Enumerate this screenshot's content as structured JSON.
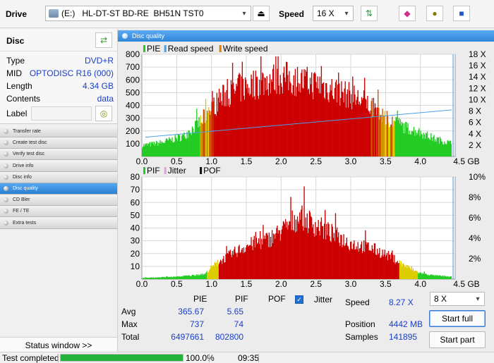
{
  "toolbar": {
    "drive_label": "Drive",
    "drive_value": "(E:)   HL-DT-ST BD-RE  BH51N TST0",
    "speed_label": "Speed",
    "speed_value": "16 X",
    "icons": [
      "eject-icon",
      "refresh-icon",
      "eraser-icon",
      "disc-copy-icon",
      "save-icon"
    ]
  },
  "disc": {
    "title": "Disc",
    "type_key": "Type",
    "type_val": "DVD+R",
    "mid_key": "MID",
    "mid_val": "OPTODISC R16 (000)",
    "length_key": "Length",
    "length_val": "4.34 GB",
    "contents_key": "Contents",
    "contents_val": "data",
    "label_key": "Label"
  },
  "nav": [
    "Transfer rate",
    "Create test disc",
    "Verify test disc",
    "Drive info",
    "Disc info",
    "Disc quality",
    "CD Bler",
    "FE / TE",
    "Extra tests"
  ],
  "nav_active": 5,
  "status_window": "Status window >>",
  "main_title": "Disc quality",
  "stats": {
    "col_pie": "PIE",
    "col_pif": "PIF",
    "col_pof": "POF",
    "col_jitter": "Jitter",
    "avg_label": "Avg",
    "avg_pie": "365.67",
    "avg_pif": "5.65",
    "max_label": "Max",
    "max_pie": "737",
    "max_pif": "74",
    "total_label": "Total",
    "total_pie": "6497661",
    "total_pif": "802800",
    "speed_label": "Speed",
    "speed_val": "8.27 X",
    "position_label": "Position",
    "position_val": "4442 MB",
    "samples_label": "Samples",
    "samples_val": "141895",
    "speed_select": "8 X",
    "start_full": "Start full",
    "start_part": "Start part"
  },
  "statusbar": {
    "text": "Test completed",
    "progress": 1.0,
    "percent": "100.0%",
    "time": "09:35"
  },
  "chart_data": [
    {
      "type": "bar",
      "legend": [
        "PIE",
        "Read speed",
        "Write speed"
      ],
      "colors": {
        "pie_low": "#22cc22",
        "pie_mid": "#ddcc00",
        "pie_high": "#cc0000",
        "read": "#4aa0e8",
        "write": "#e07a00"
      },
      "x_ticks": [
        "0.0",
        "0.5",
        "1.0",
        "1.5",
        "2.0",
        "2.5",
        "3.0",
        "3.5",
        "4.0",
        "4.5 GB"
      ],
      "y_left_ticks": [
        "100",
        "200",
        "300",
        "400",
        "500",
        "600",
        "700",
        "800"
      ],
      "y_right_ticks": [
        "2 X",
        "4 X",
        "6 X",
        "8 X",
        "10 X",
        "12 X",
        "14 X",
        "16 X",
        "18 X"
      ],
      "xlim": [
        0,
        4.5
      ],
      "ylim": [
        0,
        800
      ],
      "y2lim": [
        0,
        18
      ],
      "profile_x": [
        0.0,
        0.3,
        0.6,
        0.8,
        1.0,
        1.2,
        1.5,
        1.8,
        2.0,
        2.2,
        2.5,
        2.8,
        3.0,
        3.2,
        3.5,
        3.8,
        4.0,
        4.2,
        4.45
      ],
      "profile_y": [
        90,
        120,
        170,
        270,
        400,
        520,
        590,
        640,
        670,
        640,
        610,
        550,
        510,
        460,
        330,
        240,
        200,
        150,
        110
      ],
      "read_speed_x": [
        0.05,
        4.45
      ],
      "read_speed_y": [
        3.4,
        8.2
      ]
    },
    {
      "type": "bar",
      "legend": [
        "PIF",
        "Jitter",
        "POF"
      ],
      "colors": {
        "pif_low": "#22cc22",
        "pif_mid": "#ddcc00",
        "pif_high": "#cc0000",
        "jitter": "#e8a0d8"
      },
      "x_ticks": [
        "0.0",
        "0.5",
        "1.0",
        "1.5",
        "2.0",
        "2.5",
        "3.0",
        "3.5",
        "4.0",
        "4.5 GB"
      ],
      "y_left_ticks": [
        "10",
        "20",
        "30",
        "40",
        "50",
        "60",
        "70",
        "80"
      ],
      "y_right_ticks": [
        "2%",
        "4%",
        "6%",
        "8%",
        "10%"
      ],
      "xlim": [
        0,
        4.5
      ],
      "ylim": [
        0,
        80
      ],
      "y2lim": [
        0,
        10
      ],
      "profile_x": [
        0.0,
        0.5,
        0.9,
        1.0,
        1.2,
        1.5,
        1.8,
        2.0,
        2.2,
        2.3,
        2.5,
        2.8,
        3.0,
        3.3,
        3.6,
        3.8,
        4.0,
        4.2,
        4.45
      ],
      "profile_y": [
        1,
        2,
        4,
        10,
        18,
        28,
        33,
        40,
        50,
        52,
        45,
        36,
        30,
        26,
        18,
        10,
        5,
        3,
        2
      ]
    }
  ]
}
